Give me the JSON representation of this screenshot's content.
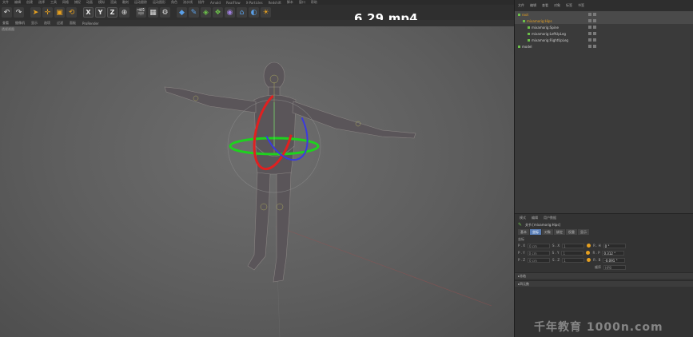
{
  "video_title": "6.29.mp4",
  "watermark": "千年教育 1000n.com",
  "menu": {
    "items": [
      "文件",
      "编辑",
      "创建",
      "选择",
      "工具",
      "网格",
      "捕捉",
      "动画",
      "模拟",
      "渲染",
      "雕刻",
      "运动跟踪",
      "运动图形",
      "角色",
      "流水线",
      "插件",
      "Arnold",
      "RealFlow",
      "X-Particles",
      "Redshift",
      "脚本",
      "窗口",
      "帮助"
    ]
  },
  "toolbar": {
    "buttons": [
      {
        "icon": "undo-icon",
        "glyph": "↶"
      },
      {
        "icon": "redo-icon",
        "glyph": "↷"
      },
      {
        "icon": "select-arrow-icon",
        "glyph": "➤"
      },
      {
        "icon": "move-icon",
        "glyph": "✛"
      },
      {
        "icon": "scale-icon",
        "glyph": "▣"
      },
      {
        "icon": "rotate-icon",
        "glyph": "⟲"
      },
      {
        "icon": "x-axis-icon",
        "glyph": "X"
      },
      {
        "icon": "y-axis-icon",
        "glyph": "Y"
      },
      {
        "icon": "z-axis-icon",
        "glyph": "Z"
      },
      {
        "icon": "coordinate-system-icon",
        "glyph": "⊕"
      },
      {
        "icon": "render-view-icon",
        "glyph": "🎬"
      },
      {
        "icon": "render-region-icon",
        "glyph": "▦"
      },
      {
        "icon": "render-settings-icon",
        "glyph": "⚙"
      },
      {
        "icon": "cube-icon",
        "glyph": "◆"
      },
      {
        "icon": "pen-icon",
        "glyph": "✎"
      },
      {
        "icon": "subdivision-icon",
        "glyph": "◈"
      },
      {
        "icon": "array-icon",
        "glyph": "❖"
      },
      {
        "icon": "deformer-icon",
        "glyph": "◉"
      },
      {
        "icon": "scene-icon",
        "glyph": "⌂"
      },
      {
        "icon": "camera-icon",
        "glyph": "◐"
      },
      {
        "icon": "light-icon",
        "glyph": "☀"
      }
    ]
  },
  "viewport": {
    "menu": [
      "查看",
      "摄像机",
      "显示",
      "选项",
      "过滤",
      "面板",
      "ProRender"
    ],
    "label": "透视视图"
  },
  "object_manager": {
    "menu": [
      "文件",
      "编辑",
      "查看",
      "对象",
      "标签",
      "书签"
    ],
    "rows": [
      {
        "name": "root",
        "indent": 0,
        "selected": true
      },
      {
        "name": "mixamorig:Hips",
        "indent": 1,
        "selected": true
      },
      {
        "name": "mixamorig:Spine",
        "indent": 2,
        "selected": false
      },
      {
        "name": "mixamorig:LeftUpLeg",
        "indent": 2,
        "selected": false
      },
      {
        "name": "mixamorig:RightUpLeg",
        "indent": 2,
        "selected": false
      },
      {
        "name": "model",
        "indent": 0,
        "selected": false
      }
    ]
  },
  "attributes": {
    "menu": [
      "模式",
      "编辑",
      "用户数据"
    ],
    "title": "关节 [mixamorig:Hips]",
    "tabs": [
      "基本",
      "坐标",
      "对象",
      "绑定",
      "权重",
      "显示"
    ],
    "active_tab": "坐标",
    "section": "坐标",
    "rows": [
      {
        "p_label": "P . X",
        "p_val": "0 cm",
        "s_label": "S . X",
        "s_val": "1",
        "r_label": "R . H",
        "r_val": "0 °"
      },
      {
        "p_label": "P . Y",
        "p_val": "0 cm",
        "s_label": "S . Y",
        "s_val": "1",
        "r_label": "R . P",
        "r_val": "0.312 °"
      },
      {
        "p_label": "P . Z",
        "p_val": "0 cm",
        "s_label": "S . Z",
        "s_val": "1",
        "r_label": "R . B",
        "r_val": "-0.091 °"
      }
    ],
    "order_label": "顺序",
    "order_value": "HPB",
    "collapsed": [
      "冻结",
      "四元数"
    ]
  }
}
